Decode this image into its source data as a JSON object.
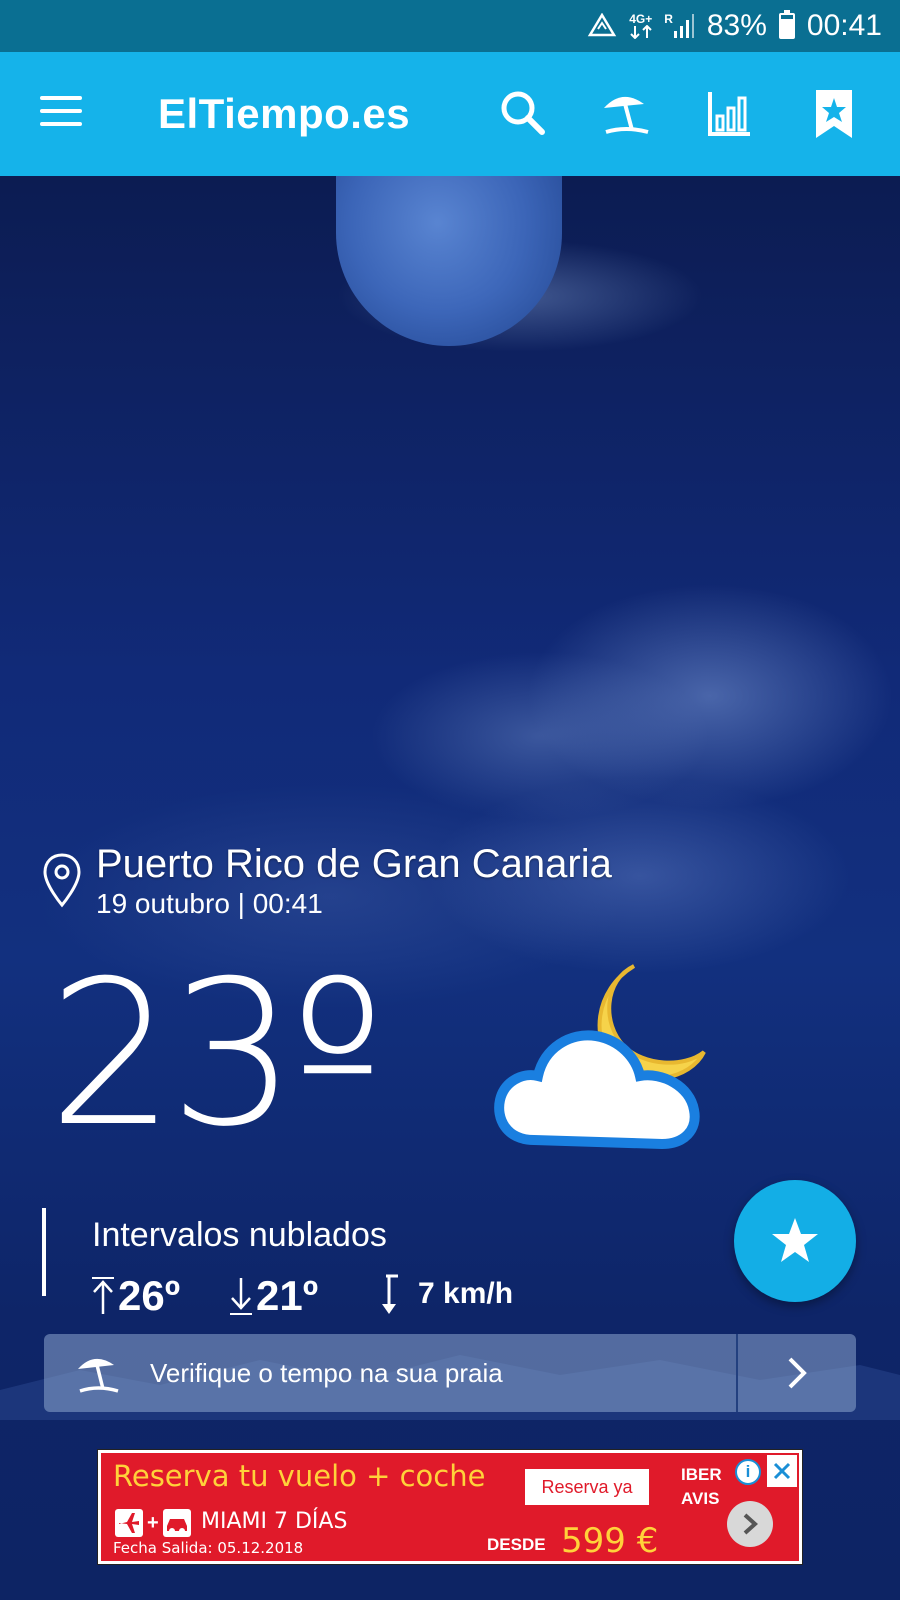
{
  "status_bar": {
    "network": "4G+",
    "roaming": "R",
    "battery_percent": "83%",
    "battery_level": 0.83,
    "time": "00:41"
  },
  "app_bar": {
    "title": "ElTiempo.es",
    "icons": [
      "menu-icon",
      "search-icon",
      "beach-umbrella-icon",
      "bar-chart-icon",
      "bookmark-star-icon"
    ]
  },
  "location": {
    "name": "Puerto Rico de Gran Canaria",
    "date_time": "19 outubro | 00:41"
  },
  "current": {
    "temperature": "23º",
    "icon": "cloud-moon-icon",
    "condition": "Intervalos nublados",
    "max_temp": "26º",
    "min_temp": "21º",
    "wind": "7 km/h"
  },
  "beach_banner": {
    "text": "Verifique o tempo na sua praia"
  },
  "ad": {
    "headline": "Reserva tu vuelo + coche",
    "cta": "Reserva ya",
    "destination": "MIAMI 7 DÍAS",
    "date": "Fecha Salida: 05.12.2018",
    "desde": "DESDE",
    "price": "599 €",
    "brand_1": "IBER",
    "brand_2": "AVIS"
  },
  "colors": {
    "status_bar": "#0a6f92",
    "app_bar": "#15b3ea",
    "fab": "#13aee6",
    "ad_background": "#e01a2a",
    "ad_accent": "#ffd23a"
  }
}
